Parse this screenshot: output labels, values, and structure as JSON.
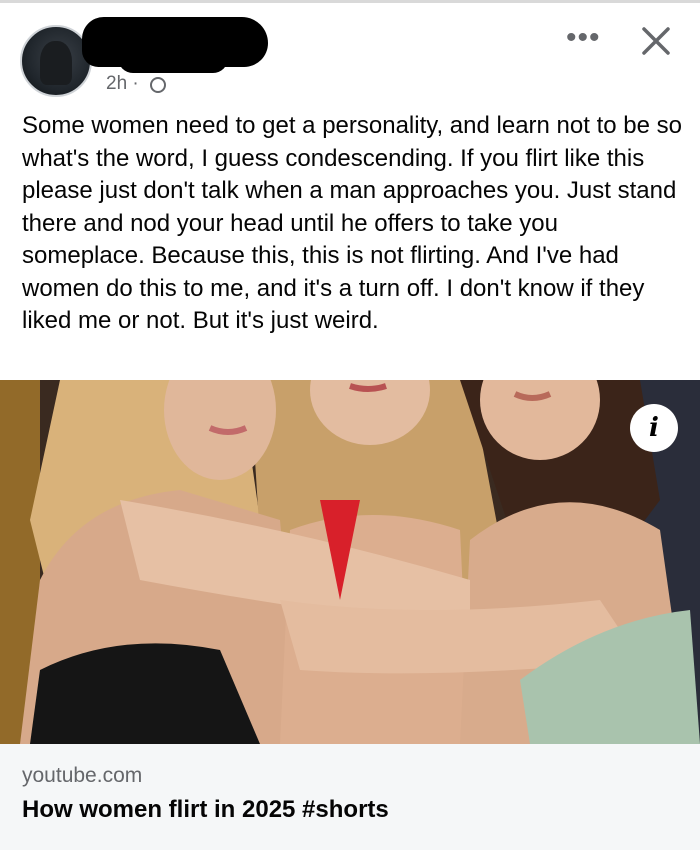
{
  "post": {
    "timestamp": "2h ·",
    "text": "Some women need to get a personality, and learn not to be so what's the word, I guess condescending. If you flirt like this please just don't talk when a man approaches you. Just stand there and nod your head until he offers to take you someplace. Because this, this is not flirting. And I've had women do this to me, and it's a turn off. I don't know if they liked me or not. But it's just weird."
  },
  "header": {
    "more_icon": "more-options-icon",
    "more_glyph": "•••",
    "close_icon": "close-icon"
  },
  "link": {
    "info_glyph": "i",
    "domain": "youtube.com",
    "title": "How women flirt in 2025 #shorts"
  },
  "colors": {
    "meta_text": "#65676b",
    "link_card_bg": "#f5f7f8",
    "redaction": "#000000"
  }
}
